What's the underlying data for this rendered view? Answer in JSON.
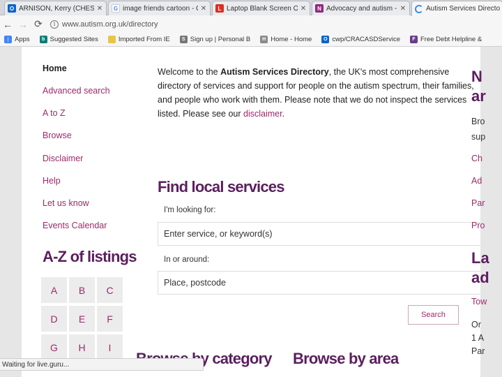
{
  "tabs": [
    {
      "title": "ARNISON, Kerry (CHESHI",
      "icon": "outlook-icon",
      "color": "#0a64c8",
      "glyph": "O"
    },
    {
      "title": "image friends cartoon - G",
      "icon": "google-icon",
      "color": "#4285f4",
      "glyph": "G"
    },
    {
      "title": "Laptop Blank Screen On",
      "icon": "laptop-site-icon",
      "color": "#d93025",
      "glyph": "L"
    },
    {
      "title": "Advocacy and autism - N",
      "icon": "nas-icon",
      "color": "#8e2a7a",
      "glyph": "N"
    },
    {
      "title": "Autism Services Director",
      "icon": "loading-spinner-icon",
      "color": "#3b8ee6",
      "glyph": ""
    }
  ],
  "toolbar": {
    "back": "←",
    "forward": "→",
    "reload": "⟳",
    "url": "www.autism.org.uk/directory"
  },
  "bookmarks": [
    {
      "label": "Apps",
      "icon": "apps-icon",
      "color": "#4285f4",
      "glyph": "⋮"
    },
    {
      "label": "Suggested Sites",
      "icon": "bing-icon",
      "color": "#0a7f7a",
      "glyph": "b"
    },
    {
      "label": "Imported From IE",
      "icon": "folder-icon",
      "color": "#e8c548",
      "glyph": ""
    },
    {
      "label": "Sign up | Personal B",
      "icon": "page-icon",
      "color": "#777777",
      "glyph": "S"
    },
    {
      "label": "Home - Home",
      "icon": "page-icon",
      "color": "#8a8a8a",
      "glyph": "H"
    },
    {
      "label": "cwp/CRACASDService",
      "icon": "outlook-icon",
      "color": "#0a64c8",
      "glyph": "O"
    },
    {
      "label": "Free Debt Helpline &",
      "icon": "debt-helpline-icon",
      "color": "#6a3c8c",
      "glyph": "F"
    }
  ],
  "sidenav": [
    "Home",
    "Advanced search",
    "A to Z",
    "Browse",
    "Disclaimer",
    "Help",
    "Let us know",
    "Events Calendar"
  ],
  "az": {
    "title": "A-Z of listings",
    "letters": [
      "A",
      "B",
      "C",
      "D",
      "E",
      "F",
      "G",
      "H",
      "I"
    ]
  },
  "welcome": {
    "intro": "Welcome to the ",
    "name": "Autism Services Directory",
    "body": ", the UK's most comprehensive directory of services and support for people on the autism spectrum, their families, and people who work with them. Please note that we do not inspect the services listed. Please see our ",
    "link": "disclaimer",
    "end": "."
  },
  "search": {
    "title": "Find local services",
    "looking_label": "I'm looking for:",
    "looking_placeholder": "Enter service, or keyword(s)",
    "around_label": "In or around:",
    "around_placeholder": "Place, postcode",
    "button": "Search"
  },
  "browse": {
    "category": "Browse by category",
    "area": "Browse by area"
  },
  "right_column": {
    "heading1": "N",
    "heading1b": "ar",
    "text1": "Bro",
    "text1b": "sup",
    "links": [
      "Ch",
      "Ad",
      "Par",
      "Pro"
    ],
    "heading2": "La",
    "heading2b": "ad",
    "links2": [
      "Tow"
    ],
    "text2": [
      "Or",
      "1 A",
      "Par"
    ]
  },
  "status": "Waiting for live.guru..."
}
